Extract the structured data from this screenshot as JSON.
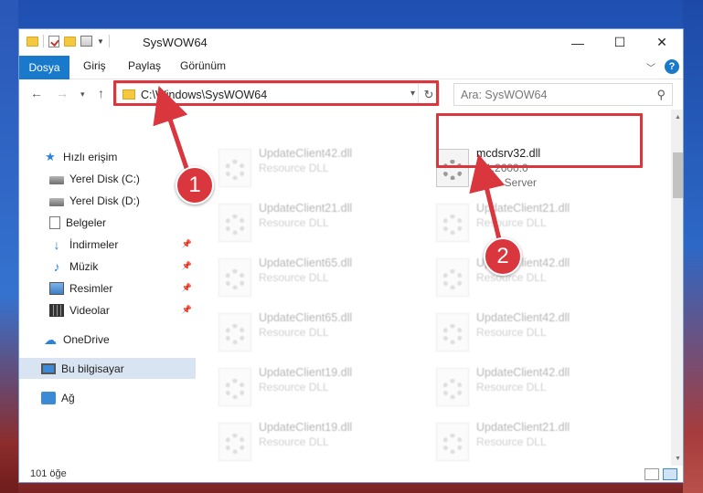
{
  "window": {
    "title": "SysWOW64",
    "controls": {
      "minimize": "—",
      "maximize": "☐",
      "close": "✕"
    }
  },
  "ribbon": {
    "tabs": [
      "Dosya",
      "Giriş",
      "Paylaş",
      "Görünüm"
    ],
    "help": "?"
  },
  "navigation": {
    "address": "C:\\Windows\\SysWOW64",
    "search_placeholder": "Ara: SysWOW64"
  },
  "sidebar": {
    "items": [
      {
        "label": "Hızlı erişim",
        "icon": "star-icon",
        "pinned": false
      },
      {
        "label": "Yerel Disk (C:)",
        "icon": "disk-icon",
        "pinned": false
      },
      {
        "label": "Yerel Disk (D:)",
        "icon": "disk-icon",
        "pinned": false
      },
      {
        "label": "Belgeler",
        "icon": "document-icon",
        "pinned": false
      },
      {
        "label": "İndirmeler",
        "icon": "download-icon",
        "pinned": true
      },
      {
        "label": "Müzik",
        "icon": "music-icon",
        "pinned": true
      },
      {
        "label": "Resimler",
        "icon": "pictures-icon",
        "pinned": true
      },
      {
        "label": "Videolar",
        "icon": "video-icon",
        "pinned": true
      },
      {
        "label": "OneDrive",
        "icon": "cloud-icon",
        "pinned": false
      },
      {
        "label": "Bu bilgisayar",
        "icon": "computer-icon",
        "pinned": false,
        "selected": true
      },
      {
        "label": "Ağ",
        "icon": "network-icon",
        "pinned": false
      }
    ]
  },
  "files": {
    "highlighted": {
      "name": "mcdsrv32.dll",
      "version": "5.1.2600.0",
      "description": "MCD Server"
    },
    "left_column": [
      {
        "name": "UpdateClient42.dll",
        "description": "Resource DLL"
      },
      {
        "name": "UpdateClient21.dll",
        "description": "Resource DLL"
      },
      {
        "name": "UpdateClient65.dll",
        "description": "Resource DLL"
      },
      {
        "name": "UpdateClient65.dll",
        "description": "Resource DLL"
      },
      {
        "name": "UpdateClient19.dll",
        "description": "Resource DLL"
      },
      {
        "name": "UpdateClient19.dll",
        "description": "Resource DLL"
      }
    ],
    "right_column": [
      {
        "name": "UpdateClient21.dll",
        "description": "Resource DLL"
      },
      {
        "name": "UpdateClient42.dll",
        "description": "Resource DLL"
      },
      {
        "name": "UpdateClient42.dll",
        "description": "Resource DLL"
      },
      {
        "name": "UpdateClient42.dll",
        "description": "Resource DLL"
      },
      {
        "name": "UpdateClient21.dll",
        "description": "Resource DLL"
      }
    ]
  },
  "status": {
    "item_count": "101 öğe"
  },
  "annotations": {
    "step1": "1",
    "step2": "2",
    "color": "#d9363e"
  }
}
